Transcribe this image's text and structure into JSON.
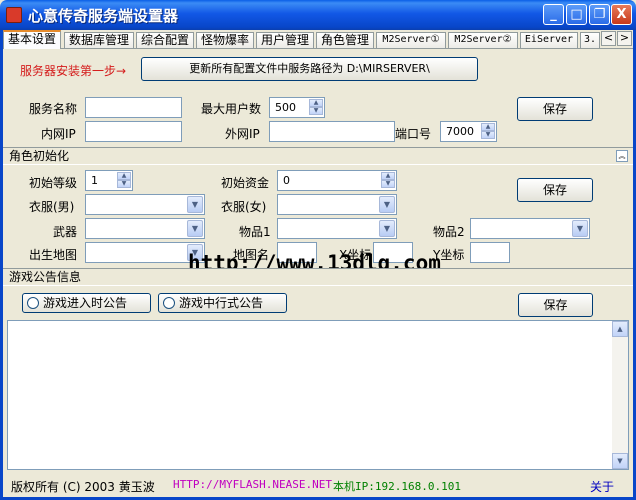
{
  "window": {
    "title": "心意传奇服务端设置器",
    "minimize": "_",
    "maximize": "□",
    "close": "X"
  },
  "tabs": [
    {
      "label": "基本设置",
      "active": true
    },
    {
      "label": "数据库管理"
    },
    {
      "label": "综合配置"
    },
    {
      "label": "怪物爆率"
    },
    {
      "label": "用户管理"
    },
    {
      "label": "角色管理"
    },
    {
      "label": "M2Server①"
    },
    {
      "label": "M2Server②"
    },
    {
      "label": "EiServer"
    },
    {
      "label": "3."
    }
  ],
  "tab_scroll": {
    "left": "<",
    "right": ">"
  },
  "install": {
    "step_label": "服务器安装第一步→",
    "update_button": "更新所有配置文件中服务路径为 D:\\MIRSERVER\\"
  },
  "server": {
    "name_label": "服务名称",
    "name_value": "",
    "max_users_label": "最大用户数",
    "max_users_value": "500",
    "lan_ip_label": "内网IP",
    "lan_ip_value": "",
    "wan_ip_label": "外网IP",
    "wan_ip_value": "",
    "port_label": "端口号",
    "port_value": "7000",
    "save_label": "保存"
  },
  "role_init": {
    "header": "角色初始化",
    "level_label": "初始等级",
    "level_value": "1",
    "gold_label": "初始资金",
    "gold_value": "0",
    "clothes_m_label": "衣服(男)",
    "clothes_f_label": "衣服(女)",
    "weapon_label": "武器",
    "item1_label": "物品1",
    "item2_label": "物品2",
    "birth_map_label": "出生地图",
    "map_no_label": "地图名",
    "x_label": "X坐标",
    "y_label": "Y坐标",
    "save_label": "保存"
  },
  "announce": {
    "header": "游戏公告信息",
    "enter_radio": "游戏进入时公告",
    "running_radio": "游戏中行式公告",
    "save_label": "保存"
  },
  "watermark": "http://www.13dlq.com",
  "status": {
    "copyright": "版权所有 (C) 2003 黄玉波",
    "url": "HTTP://MYFLASH.NEASE.NET",
    "ip": "本机IP:192.168.0.101",
    "about": "关于"
  },
  "colors": {
    "title_bar": "#0846C9",
    "url_text": "#C000C0",
    "ip_text": "#008000",
    "about_text": "#0000C0",
    "step_text": "#D41A1A"
  }
}
